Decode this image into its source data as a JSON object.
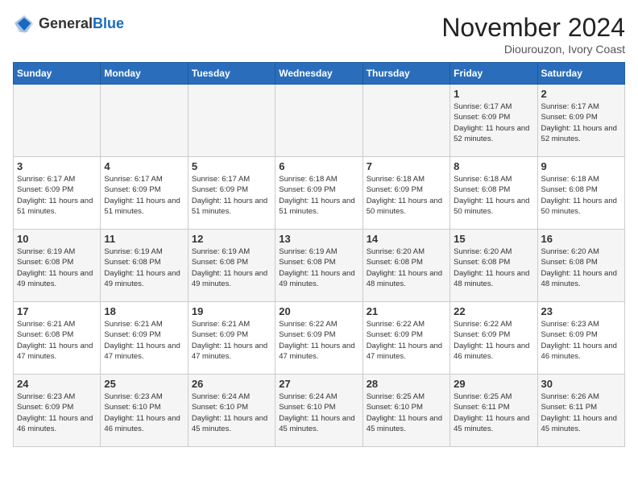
{
  "logo": {
    "general": "General",
    "blue": "Blue"
  },
  "title": "November 2024",
  "location": "Diourouzon, Ivory Coast",
  "days_of_week": [
    "Sunday",
    "Monday",
    "Tuesday",
    "Wednesday",
    "Thursday",
    "Friday",
    "Saturday"
  ],
  "weeks": [
    [
      {
        "day": "",
        "info": ""
      },
      {
        "day": "",
        "info": ""
      },
      {
        "day": "",
        "info": ""
      },
      {
        "day": "",
        "info": ""
      },
      {
        "day": "",
        "info": ""
      },
      {
        "day": "1",
        "info": "Sunrise: 6:17 AM\nSunset: 6:09 PM\nDaylight: 11 hours and 52 minutes."
      },
      {
        "day": "2",
        "info": "Sunrise: 6:17 AM\nSunset: 6:09 PM\nDaylight: 11 hours and 52 minutes."
      }
    ],
    [
      {
        "day": "3",
        "info": "Sunrise: 6:17 AM\nSunset: 6:09 PM\nDaylight: 11 hours and 51 minutes."
      },
      {
        "day": "4",
        "info": "Sunrise: 6:17 AM\nSunset: 6:09 PM\nDaylight: 11 hours and 51 minutes."
      },
      {
        "day": "5",
        "info": "Sunrise: 6:17 AM\nSunset: 6:09 PM\nDaylight: 11 hours and 51 minutes."
      },
      {
        "day": "6",
        "info": "Sunrise: 6:18 AM\nSunset: 6:09 PM\nDaylight: 11 hours and 51 minutes."
      },
      {
        "day": "7",
        "info": "Sunrise: 6:18 AM\nSunset: 6:09 PM\nDaylight: 11 hours and 50 minutes."
      },
      {
        "day": "8",
        "info": "Sunrise: 6:18 AM\nSunset: 6:08 PM\nDaylight: 11 hours and 50 minutes."
      },
      {
        "day": "9",
        "info": "Sunrise: 6:18 AM\nSunset: 6:08 PM\nDaylight: 11 hours and 50 minutes."
      }
    ],
    [
      {
        "day": "10",
        "info": "Sunrise: 6:19 AM\nSunset: 6:08 PM\nDaylight: 11 hours and 49 minutes."
      },
      {
        "day": "11",
        "info": "Sunrise: 6:19 AM\nSunset: 6:08 PM\nDaylight: 11 hours and 49 minutes."
      },
      {
        "day": "12",
        "info": "Sunrise: 6:19 AM\nSunset: 6:08 PM\nDaylight: 11 hours and 49 minutes."
      },
      {
        "day": "13",
        "info": "Sunrise: 6:19 AM\nSunset: 6:08 PM\nDaylight: 11 hours and 49 minutes."
      },
      {
        "day": "14",
        "info": "Sunrise: 6:20 AM\nSunset: 6:08 PM\nDaylight: 11 hours and 48 minutes."
      },
      {
        "day": "15",
        "info": "Sunrise: 6:20 AM\nSunset: 6:08 PM\nDaylight: 11 hours and 48 minutes."
      },
      {
        "day": "16",
        "info": "Sunrise: 6:20 AM\nSunset: 6:08 PM\nDaylight: 11 hours and 48 minutes."
      }
    ],
    [
      {
        "day": "17",
        "info": "Sunrise: 6:21 AM\nSunset: 6:08 PM\nDaylight: 11 hours and 47 minutes."
      },
      {
        "day": "18",
        "info": "Sunrise: 6:21 AM\nSunset: 6:09 PM\nDaylight: 11 hours and 47 minutes."
      },
      {
        "day": "19",
        "info": "Sunrise: 6:21 AM\nSunset: 6:09 PM\nDaylight: 11 hours and 47 minutes."
      },
      {
        "day": "20",
        "info": "Sunrise: 6:22 AM\nSunset: 6:09 PM\nDaylight: 11 hours and 47 minutes."
      },
      {
        "day": "21",
        "info": "Sunrise: 6:22 AM\nSunset: 6:09 PM\nDaylight: 11 hours and 47 minutes."
      },
      {
        "day": "22",
        "info": "Sunrise: 6:22 AM\nSunset: 6:09 PM\nDaylight: 11 hours and 46 minutes."
      },
      {
        "day": "23",
        "info": "Sunrise: 6:23 AM\nSunset: 6:09 PM\nDaylight: 11 hours and 46 minutes."
      }
    ],
    [
      {
        "day": "24",
        "info": "Sunrise: 6:23 AM\nSunset: 6:09 PM\nDaylight: 11 hours and 46 minutes."
      },
      {
        "day": "25",
        "info": "Sunrise: 6:23 AM\nSunset: 6:10 PM\nDaylight: 11 hours and 46 minutes."
      },
      {
        "day": "26",
        "info": "Sunrise: 6:24 AM\nSunset: 6:10 PM\nDaylight: 11 hours and 45 minutes."
      },
      {
        "day": "27",
        "info": "Sunrise: 6:24 AM\nSunset: 6:10 PM\nDaylight: 11 hours and 45 minutes."
      },
      {
        "day": "28",
        "info": "Sunrise: 6:25 AM\nSunset: 6:10 PM\nDaylight: 11 hours and 45 minutes."
      },
      {
        "day": "29",
        "info": "Sunrise: 6:25 AM\nSunset: 6:11 PM\nDaylight: 11 hours and 45 minutes."
      },
      {
        "day": "30",
        "info": "Sunrise: 6:26 AM\nSunset: 6:11 PM\nDaylight: 11 hours and 45 minutes."
      }
    ]
  ]
}
